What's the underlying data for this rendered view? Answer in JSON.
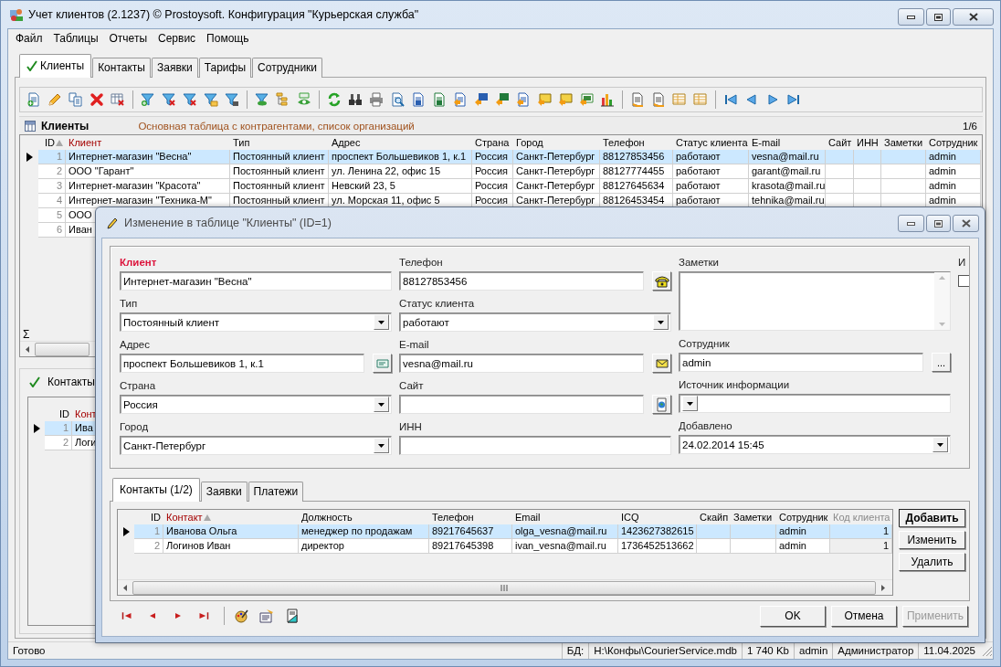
{
  "window": {
    "title": "Учет клиентов (2.1237) © Prostoysoft. Конфигурация \"Курьерская служба\""
  },
  "menu": [
    "Файл",
    "Таблицы",
    "Отчеты",
    "Сервис",
    "Помощь"
  ],
  "tabs": [
    {
      "label": "Клиенты",
      "selected": true
    },
    {
      "label": "Контакты",
      "selected": false
    },
    {
      "label": "Заявки",
      "selected": false
    },
    {
      "label": "Тарифы",
      "selected": false
    },
    {
      "label": "Сотрудники",
      "selected": false
    }
  ],
  "table_panel": {
    "title": "Клиенты",
    "description": "Основная таблица с контрагентами, список организаций",
    "counter": "1/6"
  },
  "table": {
    "columns": [
      {
        "label": "ID",
        "sorted": true,
        "key": false
      },
      {
        "label": "Клиент",
        "sorted": false,
        "key": true
      },
      {
        "label": "Тип",
        "sorted": false,
        "key": false
      },
      {
        "label": "Адрес",
        "sorted": false,
        "key": false
      },
      {
        "label": "Страна",
        "sorted": false,
        "key": false
      },
      {
        "label": "Город",
        "sorted": false,
        "key": false
      },
      {
        "label": "Телефон",
        "sorted": false,
        "key": false
      },
      {
        "label": "Статус клиента",
        "sorted": false,
        "key": false
      },
      {
        "label": "E-mail",
        "sorted": false,
        "key": false
      },
      {
        "label": "Сайт",
        "sorted": false,
        "key": false
      },
      {
        "label": "ИНН",
        "sorted": false,
        "key": false
      },
      {
        "label": "Заметки",
        "sorted": false,
        "key": false
      },
      {
        "label": "Сотрудник",
        "sorted": false,
        "key": false
      }
    ],
    "rows": [
      {
        "selected": true,
        "cells": [
          "1",
          "Интернет-магазин \"Весна\"",
          "Постоянный клиент",
          "проспект Большевиков 1, к.1",
          "Россия",
          "Санкт-Петербург",
          "88127853456",
          "работают",
          "vesna@mail.ru",
          null,
          null,
          null,
          "admin"
        ]
      },
      {
        "selected": false,
        "cells": [
          "2",
          "ООО \"Гарант\"",
          "Постоянный клиент",
          "ул. Ленина 22, офис 15",
          "Россия",
          "Санкт-Петербург",
          "88127774455",
          "работают",
          "garant@mail.ru",
          null,
          null,
          null,
          "admin"
        ]
      },
      {
        "selected": false,
        "cells": [
          "3",
          "Интернет-магазин \"Красота\"",
          "Постоянный клиент",
          "Невский 23, 5",
          "Россия",
          "Санкт-Петербург",
          "88127645634",
          "работают",
          "krasota@mail.ru",
          null,
          null,
          null,
          "admin"
        ]
      },
      {
        "selected": false,
        "cells": [
          "4",
          "Интернет-магазин \"Техника-М\"",
          "Постоянный клиент",
          "ул. Морская 11, офис 5",
          "Россия",
          "Санкт-Петербург",
          "88126453454",
          "работают",
          "tehnika@mail.ru",
          null,
          null,
          null,
          "admin"
        ]
      },
      {
        "selected": false,
        "cells": [
          "5",
          "ООО"
        ]
      },
      {
        "selected": false,
        "cells": [
          "6",
          "Иван"
        ]
      }
    ],
    "summary_mark": "Σ"
  },
  "contacts_panel": {
    "title": "Контакты",
    "checked": true,
    "columns": [
      {
        "label": "ID",
        "key": false
      },
      {
        "label": "Конт",
        "key": true
      }
    ],
    "rows": [
      {
        "selected": true,
        "cells": [
          "1",
          "Ива"
        ]
      },
      {
        "selected": false,
        "cells": [
          "2",
          "Логи"
        ]
      }
    ]
  },
  "dialog": {
    "title": "Изменение в таблице \"Клиенты\" (ID=1)",
    "form_columns": [
      {
        "fields": [
          {
            "label": "Клиент",
            "required": true,
            "kind": "text",
            "value": "Интернет-магазин \"Весна\""
          },
          {
            "label": "Тип",
            "required": false,
            "kind": "select",
            "value": "Постоянный клиент"
          },
          {
            "label": "Адрес",
            "required": false,
            "kind": "text",
            "value": "проспект Большевиков 1, к.1",
            "button": {
              "kind": "address"
            }
          },
          {
            "label": "Страна",
            "required": false,
            "kind": "select",
            "value": "Россия"
          },
          {
            "label": "Город",
            "required": false,
            "kind": "select",
            "value": "Санкт-Петербург"
          }
        ]
      },
      {
        "fields": [
          {
            "label": "Телефон",
            "required": false,
            "kind": "text",
            "value": "88127853456",
            "button": {
              "kind": "phone"
            }
          },
          {
            "label": "Статус клиента",
            "required": false,
            "kind": "select",
            "value": "работают"
          },
          {
            "label": "E-mail",
            "required": false,
            "kind": "text",
            "value": "vesna@mail.ru",
            "button": {
              "kind": "email"
            }
          },
          {
            "label": "Сайт",
            "required": false,
            "kind": "text",
            "button": {
              "kind": "web"
            }
          },
          {
            "label": "ИНН",
            "required": false,
            "kind": "text"
          }
        ]
      },
      {
        "fields": [
          {
            "label": "Заметки",
            "required": false,
            "kind": "memo"
          },
          {
            "label": "Сотрудник",
            "required": false,
            "kind": "text",
            "value": "admin",
            "button": {
              "kind": "more",
              "label": "..."
            }
          },
          {
            "label": "Источник информации",
            "required": false,
            "kind": "select"
          },
          {
            "label": "Добавлено",
            "required": false,
            "kind": "select",
            "value": "24.02.2014 15:45"
          }
        ]
      }
    ],
    "flag": {
      "label": "И",
      "checked": false
    },
    "tabs": [
      {
        "label": "Контакты (1/2)",
        "selected": true
      },
      {
        "label": "Заявки",
        "selected": false
      },
      {
        "label": "Платежи",
        "selected": false
      }
    ],
    "grid": {
      "columns": [
        {
          "label": "ID",
          "sorted": false,
          "key": false,
          "readonly": false
        },
        {
          "label": "Контакт",
          "sorted": true,
          "key": true,
          "readonly": false
        },
        {
          "label": "Должность",
          "sorted": false,
          "key": false,
          "readonly": false
        },
        {
          "label": "Телефон",
          "sorted": false,
          "key": false,
          "readonly": false
        },
        {
          "label": "Email",
          "sorted": false,
          "key": false,
          "readonly": false
        },
        {
          "label": "ICQ",
          "sorted": false,
          "key": false,
          "readonly": false
        },
        {
          "label": "Скайп",
          "sorted": false,
          "key": false,
          "readonly": false
        },
        {
          "label": "Заметки",
          "sorted": false,
          "key": false,
          "readonly": false
        },
        {
          "label": "Сотрудник",
          "sorted": false,
          "key": false,
          "readonly": false
        },
        {
          "label": "Код клиента",
          "sorted": false,
          "key": false,
          "readonly": true
        }
      ],
      "rows": [
        {
          "selected": true,
          "cells": [
            "1",
            "Иванова Ольга",
            "менеджер по продажам",
            "89217645637",
            "olga_vesna@mail.ru",
            "1423627382615",
            null,
            null,
            "admin",
            "1"
          ]
        },
        {
          "selected": false,
          "cells": [
            "2",
            "Логинов Иван",
            "директор",
            "89217645398",
            "ivan_vesna@mail.ru",
            "1736452513662",
            null,
            null,
            "admin",
            "1"
          ]
        }
      ]
    },
    "side_buttons": [
      {
        "label": "Добавить",
        "default": true
      },
      {
        "label": "Изменить",
        "default": false
      },
      {
        "label": "Удалить",
        "default": false
      }
    ],
    "buttons": [
      {
        "label": "OK",
        "disabled": false
      },
      {
        "label": "Отмена",
        "disabled": false
      },
      {
        "label": "Применить",
        "disabled": true
      }
    ]
  },
  "status_bar": [
    "Готово",
    "БД:",
    "H:\\Конфы\\CourierService.mdb",
    "1 740 Kb",
    "admin",
    "Администратор",
    "11.04.2025"
  ]
}
